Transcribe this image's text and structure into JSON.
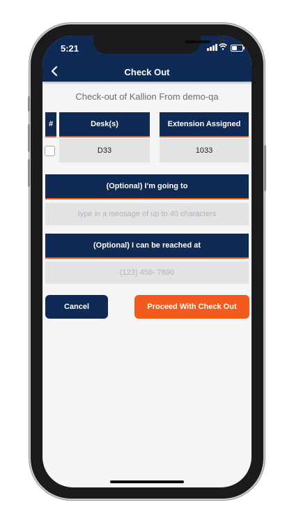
{
  "status_bar": {
    "time": "5:21"
  },
  "nav": {
    "title": "Check Out"
  },
  "subtitle": "Check-out of Kallion From demo-qa",
  "table": {
    "headers": {
      "index": "#",
      "desks": "Desk(s)",
      "extension": "Extension Assigned"
    },
    "rows": [
      {
        "desk": "D33",
        "extension": "1033"
      }
    ]
  },
  "going_to": {
    "label": "(Optional) I'm going to",
    "placeholder": "type in a message of up to 40 characters"
  },
  "reached_at": {
    "label": "(Optional) I can be reached at",
    "placeholder": "(123) 456- 7890"
  },
  "buttons": {
    "cancel": "Cancel",
    "proceed": "Proceed With Check Out"
  },
  "colors": {
    "navy": "#0f2b55",
    "accent": "#f25a1e",
    "divider": "#e25a1c"
  },
  "icons": {
    "back": "chevron-left-icon",
    "signal": "cellular-signal-icon",
    "wifi": "wifi-icon",
    "battery": "battery-icon"
  }
}
